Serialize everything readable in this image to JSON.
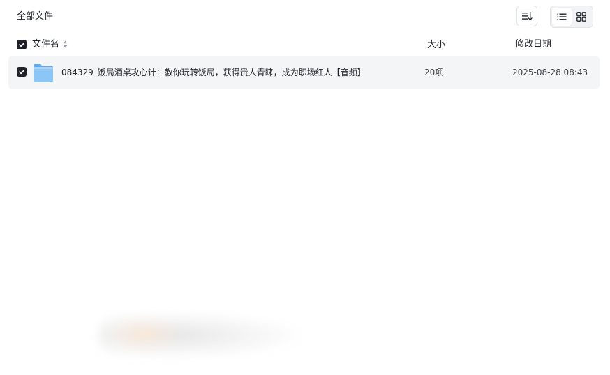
{
  "breadcrumb": {
    "label": "全部文件"
  },
  "toolbar": {
    "sort_icon": "sort-lines-icon",
    "view_list_icon": "list-view-icon",
    "view_grid_icon": "grid-view-icon",
    "active_view": "list"
  },
  "table": {
    "columns": {
      "name": "文件名",
      "size": "大小",
      "modified": "修改日期"
    },
    "header_checked": true,
    "rows": [
      {
        "type": "folder",
        "icon": "folder-icon",
        "checked": true,
        "name": "084329_饭局酒桌攻心计：教你玩转饭局，获得贵人青睐，成为职场红人【音频】",
        "size": "20项",
        "modified": "2025-08-28 08:43"
      }
    ]
  },
  "colors": {
    "text": "#1f2329",
    "checkbox": "#1f2329",
    "row_bg": "#f4f5f7",
    "folder": "#7cbcf5",
    "border": "#e3e5e8"
  }
}
